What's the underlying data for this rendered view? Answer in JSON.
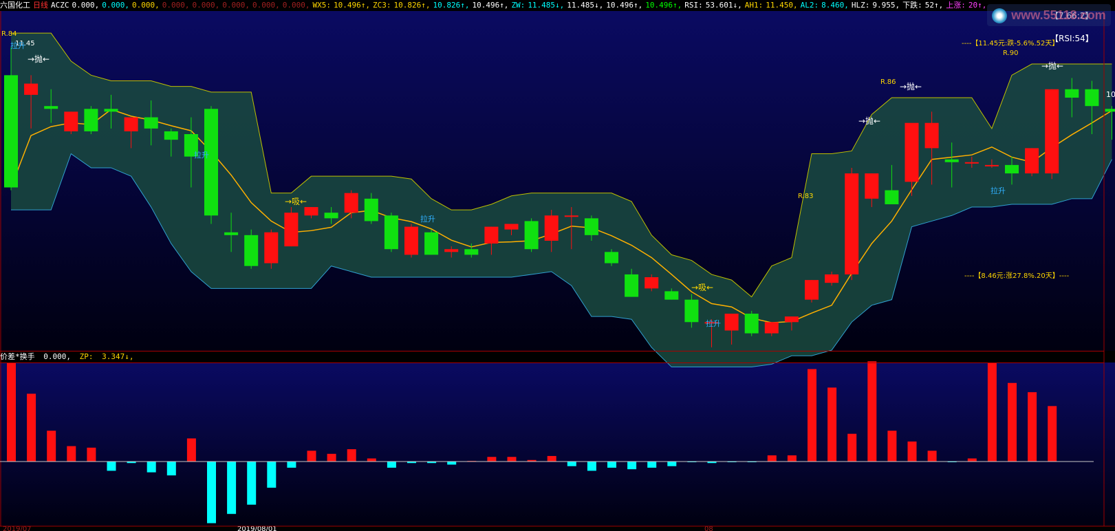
{
  "header": {
    "stock_name": "六国化工",
    "period": "日线",
    "indicators": [
      {
        "text": "ACZC",
        "color": "#ffffff"
      },
      {
        "text": "0.000,",
        "color": "#ffffff"
      },
      {
        "text": "0.000,",
        "color": "#00ffff"
      },
      {
        "text": "0.000,",
        "color": "#ffd700"
      },
      {
        "text": "0.000,",
        "color": "#a02020"
      },
      {
        "text": "0.000,",
        "color": "#a02020"
      },
      {
        "text": "0.000,",
        "color": "#a02020"
      },
      {
        "text": "0.000,",
        "color": "#a02020"
      },
      {
        "text": "0.000,",
        "color": "#a02020"
      },
      {
        "text": "WX5:",
        "color": "#ffd700"
      },
      {
        "text": "10.496↑,",
        "color": "#ffd700"
      },
      {
        "text": "ZC3:",
        "color": "#ffd700"
      },
      {
        "text": "10.826↑,",
        "color": "#ffd700"
      },
      {
        "text": "10.826↑,",
        "color": "#00ffff"
      },
      {
        "text": "10.496↑,",
        "color": "#ffffff"
      },
      {
        "text": "ZW:",
        "color": "#00ffff"
      },
      {
        "text": "11.485↓,",
        "color": "#00ffff"
      },
      {
        "text": "11.485↓,",
        "color": "#ffffff"
      },
      {
        "text": "10.496↑,",
        "color": "#ffffff"
      },
      {
        "text": "10.496↑,",
        "color": "#00ff00"
      },
      {
        "text": "RSI:",
        "color": "#ffffff"
      },
      {
        "text": "53.601↓,",
        "color": "#ffffff"
      },
      {
        "text": "AH1:",
        "color": "#ffd700"
      },
      {
        "text": "11.450,",
        "color": "#ffd700"
      },
      {
        "text": "AL2:",
        "color": "#00ffff"
      },
      {
        "text": "8.460,",
        "color": "#00ffff"
      },
      {
        "text": "HLZ:",
        "color": "#ffffff"
      },
      {
        "text": "9.955,",
        "color": "#ffffff"
      },
      {
        "text": "下跌:",
        "color": "#ffffff"
      },
      {
        "text": "52↑,",
        "color": "#ffffff"
      },
      {
        "text": "上涨:",
        "color": "#ff40ff"
      },
      {
        "text": "20↑,",
        "color": "#ff40ff"
      }
    ]
  },
  "watermark": {
    "text": "www.55118.com"
  },
  "annotations": {
    "sell": "→抛←",
    "buy": "→吸←",
    "pull_up": "拉升",
    "r_labels": [
      "R.84",
      "R.86",
      "R.90",
      "R.83"
    ],
    "price_left": "11.45",
    "rsi_box": "【RSI:54】",
    "price_box": "【7.66:2】",
    "upper_note": "----【11.45元:跌-5.6%.52天】",
    "lower_note": "----【8.46元:涨27.8%.20天】----",
    "axis_right": "10"
  },
  "sub_header": {
    "name": "价差*换手",
    "value1": "0.000,",
    "zp_label": "ZP:",
    "zp_value": "3.347↓,"
  },
  "bottom_labels": [
    "2019/07",
    "2019/08/01",
    "08"
  ],
  "colors": {
    "bg_top": "#0a0a62",
    "bg_bottom": "#000008",
    "up": "#ff1010",
    "down": "#10e010",
    "cyan_bar": "#00ffff",
    "band_fill": "#1a4a40",
    "band_fill_up": "#6a1a60",
    "ma_line": "#ffb000",
    "upper_line": "#c0c000",
    "lower_line": "#30a0d0",
    "magenta_line": "#ff30ff",
    "border": "#a00000"
  },
  "chart_data": {
    "type": "candlestick",
    "price_range": [
      6.6,
      12.3
    ],
    "candles": [
      {
        "o": 11.45,
        "h": 11.95,
        "l": 9.4,
        "c": 9.45
      },
      {
        "o": 11.1,
        "h": 11.45,
        "l": 10.5,
        "c": 11.3
      },
      {
        "o": 10.9,
        "h": 11.2,
        "l": 10.6,
        "c": 10.85
      },
      {
        "o": 10.45,
        "h": 10.8,
        "l": 10.4,
        "c": 10.8
      },
      {
        "o": 10.85,
        "h": 10.9,
        "l": 10.4,
        "c": 10.45
      },
      {
        "o": 10.85,
        "h": 11.1,
        "l": 10.5,
        "c": 10.8
      },
      {
        "o": 10.45,
        "h": 10.7,
        "l": 10.15,
        "c": 10.7
      },
      {
        "o": 10.7,
        "h": 11.0,
        "l": 10.2,
        "c": 10.5
      },
      {
        "o": 10.45,
        "h": 10.5,
        "l": 10.0,
        "c": 10.3
      },
      {
        "o": 10.4,
        "h": 10.7,
        "l": 9.45,
        "c": 10.0
      },
      {
        "o": 10.85,
        "h": 10.9,
        "l": 8.8,
        "c": 8.95
      },
      {
        "o": 8.65,
        "h": 9.0,
        "l": 8.3,
        "c": 8.6
      },
      {
        "o": 8.6,
        "h": 8.7,
        "l": 8.0,
        "c": 8.05
      },
      {
        "o": 8.1,
        "h": 8.7,
        "l": 8.0,
        "c": 8.65
      },
      {
        "o": 8.4,
        "h": 9.1,
        "l": 8.4,
        "c": 9.0
      },
      {
        "o": 8.95,
        "h": 9.1,
        "l": 8.9,
        "c": 9.1
      },
      {
        "o": 9.0,
        "h": 9.1,
        "l": 8.8,
        "c": 8.9
      },
      {
        "o": 9.0,
        "h": 9.4,
        "l": 8.9,
        "c": 9.35
      },
      {
        "o": 9.25,
        "h": 9.35,
        "l": 8.8,
        "c": 8.85
      },
      {
        "o": 8.95,
        "h": 9.0,
        "l": 8.3,
        "c": 8.35
      },
      {
        "o": 8.25,
        "h": 8.8,
        "l": 8.2,
        "c": 8.75
      },
      {
        "o": 8.65,
        "h": 8.7,
        "l": 8.25,
        "c": 8.25
      },
      {
        "o": 8.3,
        "h": 8.4,
        "l": 8.2,
        "c": 8.35
      },
      {
        "o": 8.35,
        "h": 8.45,
        "l": 8.2,
        "c": 8.25
      },
      {
        "o": 8.45,
        "h": 8.75,
        "l": 8.25,
        "c": 8.75
      },
      {
        "o": 8.7,
        "h": 8.8,
        "l": 8.6,
        "c": 8.8
      },
      {
        "o": 8.85,
        "h": 8.9,
        "l": 8.3,
        "c": 8.35
      },
      {
        "o": 8.5,
        "h": 9.05,
        "l": 8.3,
        "c": 8.95
      },
      {
        "o": 8.95,
        "h": 9.1,
        "l": 8.35,
        "c": 8.95
      },
      {
        "o": 8.9,
        "h": 8.95,
        "l": 8.5,
        "c": 8.6
      },
      {
        "o": 8.3,
        "h": 8.35,
        "l": 8.05,
        "c": 8.1
      },
      {
        "o": 7.9,
        "h": 8.0,
        "l": 7.5,
        "c": 7.5
      },
      {
        "o": 7.65,
        "h": 7.9,
        "l": 7.6,
        "c": 7.85
      },
      {
        "o": 7.6,
        "h": 7.65,
        "l": 7.45,
        "c": 7.45
      },
      {
        "o": 7.45,
        "h": 7.55,
        "l": 6.95,
        "c": 7.05
      },
      {
        "o": 7.05,
        "h": 7.1,
        "l": 6.6,
        "c": 7.05
      },
      {
        "o": 6.9,
        "h": 7.2,
        "l": 6.65,
        "c": 7.2
      },
      {
        "o": 7.2,
        "h": 7.25,
        "l": 6.8,
        "c": 6.85
      },
      {
        "o": 6.85,
        "h": 7.05,
        "l": 6.8,
        "c": 7.05
      },
      {
        "o": 7.05,
        "h": 7.15,
        "l": 6.9,
        "c": 7.15
      },
      {
        "o": 7.45,
        "h": 7.8,
        "l": 7.4,
        "c": 7.8
      },
      {
        "o": 7.75,
        "h": 7.95,
        "l": 7.7,
        "c": 7.9
      },
      {
        "o": 7.9,
        "h": 9.8,
        "l": 7.8,
        "c": 9.7
      },
      {
        "o": 9.25,
        "h": 9.7,
        "l": 9.1,
        "c": 9.7
      },
      {
        "o": 9.4,
        "h": 9.85,
        "l": 9.2,
        "c": 9.15
      },
      {
        "o": 9.55,
        "h": 10.5,
        "l": 9.3,
        "c": 10.6
      },
      {
        "o": 10.15,
        "h": 10.8,
        "l": 9.5,
        "c": 10.6
      },
      {
        "o": 9.95,
        "h": 10.25,
        "l": 9.45,
        "c": 9.9
      },
      {
        "o": 9.9,
        "h": 10.0,
        "l": 9.8,
        "c": 9.9
      },
      {
        "o": 9.85,
        "h": 9.95,
        "l": 9.8,
        "c": 9.85
      },
      {
        "o": 9.85,
        "h": 10.0,
        "l": 9.5,
        "c": 9.7
      },
      {
        "o": 9.7,
        "h": 10.15,
        "l": 9.65,
        "c": 10.15
      },
      {
        "o": 9.7,
        "h": 11.2,
        "l": 9.6,
        "c": 11.2
      },
      {
        "o": 11.2,
        "h": 11.4,
        "l": 10.7,
        "c": 11.05
      },
      {
        "o": 11.2,
        "h": 11.35,
        "l": 10.4,
        "c": 10.9
      },
      {
        "o": 10.85,
        "h": 10.9,
        "l": 10.3,
        "c": 10.8
      }
    ],
    "volume_diff": [
      3.2,
      2.2,
      1.0,
      0.5,
      0.45,
      -0.3,
      -0.05,
      -0.35,
      -0.45,
      0.75,
      -2.0,
      -1.7,
      -1.4,
      -0.85,
      -0.2,
      0.35,
      0.25,
      0.4,
      0.1,
      -0.2,
      -0.05,
      -0.05,
      -0.1,
      0.02,
      0.15,
      0.15,
      0.05,
      0.18,
      -0.15,
      -0.3,
      -0.2,
      -0.25,
      -0.2,
      -0.15,
      -0.02,
      -0.05,
      -0.02,
      -0.01,
      0.2,
      0.2,
      3.0,
      2.4,
      0.9,
      3.25,
      1.0,
      0.65,
      0.35,
      -0.02,
      0.1,
      3.2,
      2.55,
      2.25,
      1.8
    ],
    "volume_range": [
      -2.0,
      3.2
    ]
  }
}
